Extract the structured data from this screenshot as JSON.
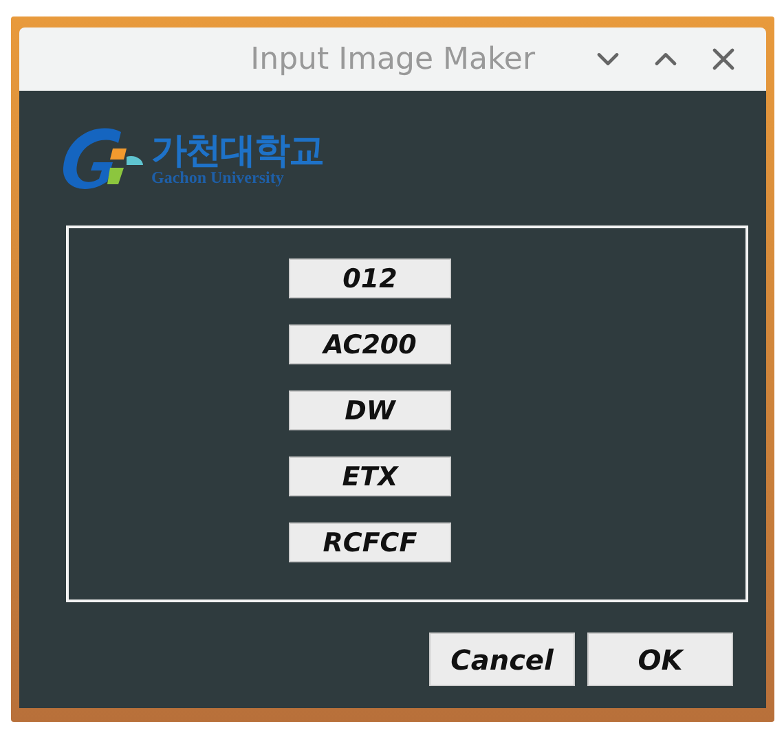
{
  "window": {
    "title": "Input Image Maker"
  },
  "logo": {
    "name": "가천대학교",
    "subtitle": "Gachon University"
  },
  "options": [
    "012",
    "AC200",
    "DW",
    "ETX",
    "RCFCF"
  ],
  "buttons": [
    "Cancel",
    "OK"
  ]
}
